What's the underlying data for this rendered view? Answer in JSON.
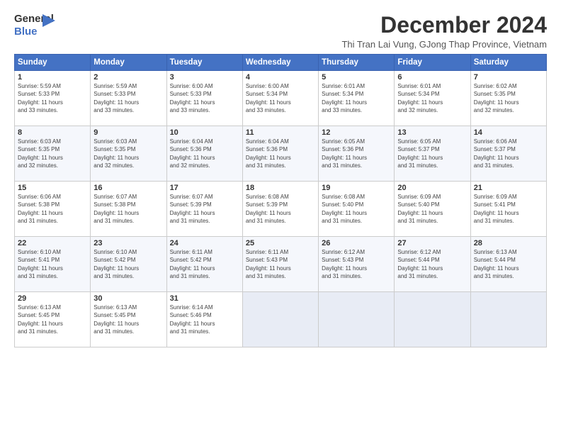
{
  "header": {
    "logo_line1": "General",
    "logo_line2": "Blue",
    "month_title": "December 2024",
    "subtitle": "Thi Tran Lai Vung, GJong Thap Province, Vietnam"
  },
  "days_of_week": [
    "Sunday",
    "Monday",
    "Tuesday",
    "Wednesday",
    "Thursday",
    "Friday",
    "Saturday"
  ],
  "weeks": [
    [
      {
        "day": "1",
        "info": "Sunrise: 5:59 AM\nSunset: 5:33 PM\nDaylight: 11 hours\nand 33 minutes."
      },
      {
        "day": "2",
        "info": "Sunrise: 5:59 AM\nSunset: 5:33 PM\nDaylight: 11 hours\nand 33 minutes."
      },
      {
        "day": "3",
        "info": "Sunrise: 6:00 AM\nSunset: 5:33 PM\nDaylight: 11 hours\nand 33 minutes."
      },
      {
        "day": "4",
        "info": "Sunrise: 6:00 AM\nSunset: 5:34 PM\nDaylight: 11 hours\nand 33 minutes."
      },
      {
        "day": "5",
        "info": "Sunrise: 6:01 AM\nSunset: 5:34 PM\nDaylight: 11 hours\nand 33 minutes."
      },
      {
        "day": "6",
        "info": "Sunrise: 6:01 AM\nSunset: 5:34 PM\nDaylight: 11 hours\nand 32 minutes."
      },
      {
        "day": "7",
        "info": "Sunrise: 6:02 AM\nSunset: 5:35 PM\nDaylight: 11 hours\nand 32 minutes."
      }
    ],
    [
      {
        "day": "8",
        "info": "Sunrise: 6:03 AM\nSunset: 5:35 PM\nDaylight: 11 hours\nand 32 minutes."
      },
      {
        "day": "9",
        "info": "Sunrise: 6:03 AM\nSunset: 5:35 PM\nDaylight: 11 hours\nand 32 minutes."
      },
      {
        "day": "10",
        "info": "Sunrise: 6:04 AM\nSunset: 5:36 PM\nDaylight: 11 hours\nand 32 minutes."
      },
      {
        "day": "11",
        "info": "Sunrise: 6:04 AM\nSunset: 5:36 PM\nDaylight: 11 hours\nand 31 minutes."
      },
      {
        "day": "12",
        "info": "Sunrise: 6:05 AM\nSunset: 5:36 PM\nDaylight: 11 hours\nand 31 minutes."
      },
      {
        "day": "13",
        "info": "Sunrise: 6:05 AM\nSunset: 5:37 PM\nDaylight: 11 hours\nand 31 minutes."
      },
      {
        "day": "14",
        "info": "Sunrise: 6:06 AM\nSunset: 5:37 PM\nDaylight: 11 hours\nand 31 minutes."
      }
    ],
    [
      {
        "day": "15",
        "info": "Sunrise: 6:06 AM\nSunset: 5:38 PM\nDaylight: 11 hours\nand 31 minutes."
      },
      {
        "day": "16",
        "info": "Sunrise: 6:07 AM\nSunset: 5:38 PM\nDaylight: 11 hours\nand 31 minutes."
      },
      {
        "day": "17",
        "info": "Sunrise: 6:07 AM\nSunset: 5:39 PM\nDaylight: 11 hours\nand 31 minutes."
      },
      {
        "day": "18",
        "info": "Sunrise: 6:08 AM\nSunset: 5:39 PM\nDaylight: 11 hours\nand 31 minutes."
      },
      {
        "day": "19",
        "info": "Sunrise: 6:08 AM\nSunset: 5:40 PM\nDaylight: 11 hours\nand 31 minutes."
      },
      {
        "day": "20",
        "info": "Sunrise: 6:09 AM\nSunset: 5:40 PM\nDaylight: 11 hours\nand 31 minutes."
      },
      {
        "day": "21",
        "info": "Sunrise: 6:09 AM\nSunset: 5:41 PM\nDaylight: 11 hours\nand 31 minutes."
      }
    ],
    [
      {
        "day": "22",
        "info": "Sunrise: 6:10 AM\nSunset: 5:41 PM\nDaylight: 11 hours\nand 31 minutes."
      },
      {
        "day": "23",
        "info": "Sunrise: 6:10 AM\nSunset: 5:42 PM\nDaylight: 11 hours\nand 31 minutes."
      },
      {
        "day": "24",
        "info": "Sunrise: 6:11 AM\nSunset: 5:42 PM\nDaylight: 11 hours\nand 31 minutes."
      },
      {
        "day": "25",
        "info": "Sunrise: 6:11 AM\nSunset: 5:43 PM\nDaylight: 11 hours\nand 31 minutes."
      },
      {
        "day": "26",
        "info": "Sunrise: 6:12 AM\nSunset: 5:43 PM\nDaylight: 11 hours\nand 31 minutes."
      },
      {
        "day": "27",
        "info": "Sunrise: 6:12 AM\nSunset: 5:44 PM\nDaylight: 11 hours\nand 31 minutes."
      },
      {
        "day": "28",
        "info": "Sunrise: 6:13 AM\nSunset: 5:44 PM\nDaylight: 11 hours\nand 31 minutes."
      }
    ],
    [
      {
        "day": "29",
        "info": "Sunrise: 6:13 AM\nSunset: 5:45 PM\nDaylight: 11 hours\nand 31 minutes."
      },
      {
        "day": "30",
        "info": "Sunrise: 6:13 AM\nSunset: 5:45 PM\nDaylight: 11 hours\nand 31 minutes."
      },
      {
        "day": "31",
        "info": "Sunrise: 6:14 AM\nSunset: 5:46 PM\nDaylight: 11 hours\nand 31 minutes."
      },
      {
        "day": "",
        "info": ""
      },
      {
        "day": "",
        "info": ""
      },
      {
        "day": "",
        "info": ""
      },
      {
        "day": "",
        "info": ""
      }
    ]
  ]
}
